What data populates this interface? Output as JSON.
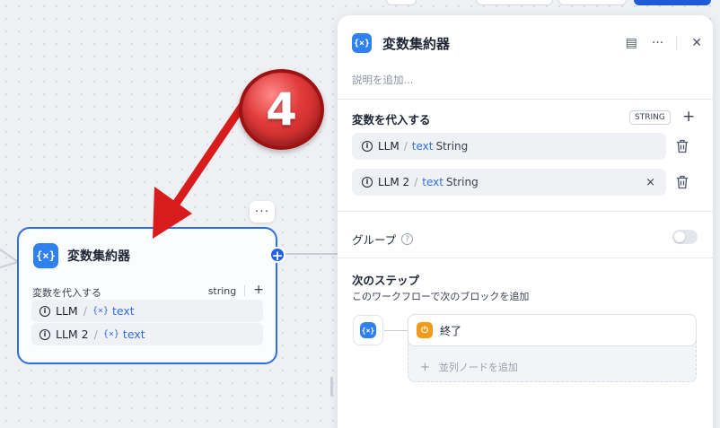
{
  "node": {
    "icon": "variable-icon",
    "icon_glyph": "{×}",
    "title": "変数集約器",
    "more": "···",
    "section_label": "変数を代入する",
    "type": "string",
    "plus": "+",
    "rows": [
      {
        "source": "LLM",
        "ref": "text"
      },
      {
        "source": "LLM 2",
        "ref": "text"
      }
    ]
  },
  "annotation": {
    "number": "4",
    "color": "#e23b3b"
  },
  "panel": {
    "title": "変数集約器",
    "description_placeholder": "説明を追加...",
    "assign_section": {
      "title": "変数を代入する",
      "type_badge": "STRING",
      "plus": "+",
      "rows": [
        {
          "source": "LLM",
          "ref": "text",
          "type": "String"
        },
        {
          "source": "LLM 2",
          "ref": "text",
          "type": "String",
          "clear": "×"
        }
      ]
    },
    "group": {
      "label": "グループ",
      "help": "?",
      "enabled": false
    },
    "next_step": {
      "title": "次のステップ",
      "subtitle": "このワークフローで次のブロックを追加",
      "end_label": "終了",
      "add_parallel": "並列ノードを追加",
      "add_plus": "+"
    }
  },
  "colors": {
    "accent": "#2f80f0",
    "primary": "#1d5bd8",
    "end": "#f29a1c"
  }
}
